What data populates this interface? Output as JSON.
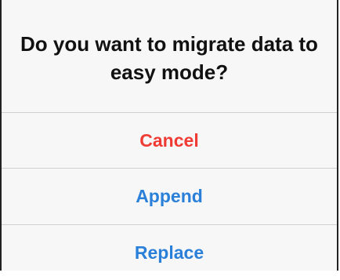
{
  "dialog": {
    "title": "Do you want to migrate data to easy mode?",
    "actions": {
      "cancel": "Cancel",
      "append": "Append",
      "replace": "Replace"
    }
  },
  "colors": {
    "cancel": "#ef3b34",
    "primary_action": "#2a80d9",
    "title": "#111111",
    "background": "#f7f7f7",
    "divider": "#d0d0d0"
  }
}
